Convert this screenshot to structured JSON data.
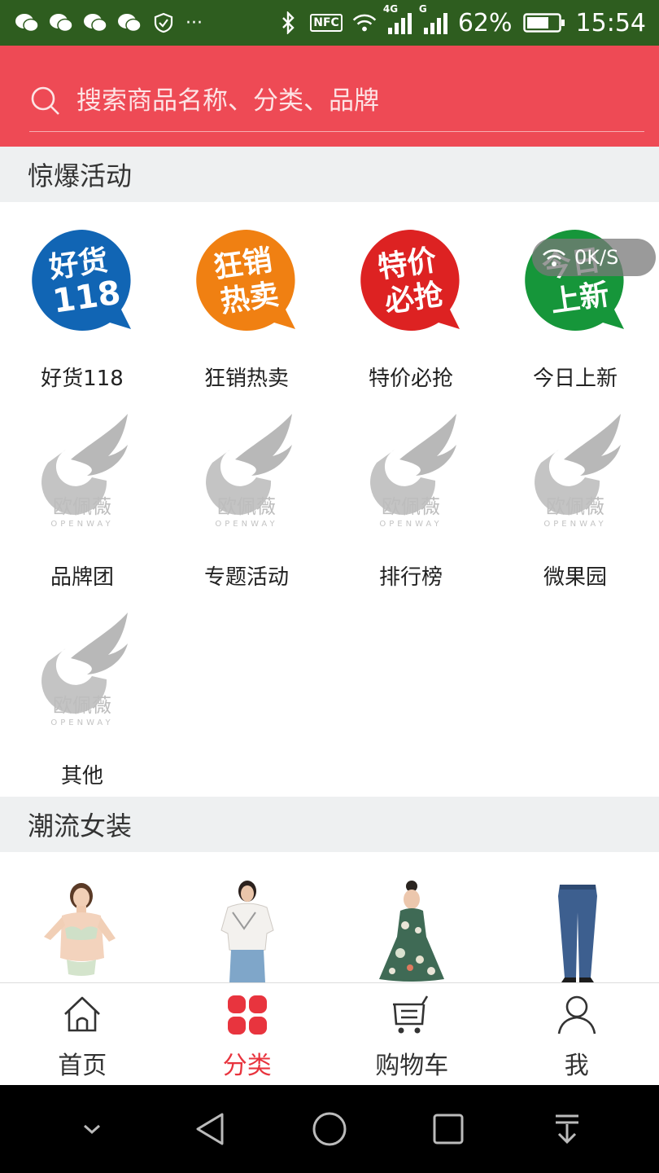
{
  "status_bar": {
    "network_4g": "4G",
    "network_g": "G",
    "nfc": "NFC",
    "battery": "62%",
    "time": "15:54",
    "more": "···"
  },
  "search": {
    "placeholder": "搜索商品名称、分类、品牌"
  },
  "sections": {
    "activities_title": "惊爆活动",
    "fashion_title": "潮流女装"
  },
  "activities": [
    {
      "label": "好货118",
      "badge_text_1": "好货",
      "badge_text_2": "118",
      "badge_color": "#1165b4"
    },
    {
      "label": "狂销热卖",
      "badge_text_1": "狂销",
      "badge_text_2": "热卖",
      "badge_color": "#f08012"
    },
    {
      "label": "特价必抢",
      "badge_text_1": "特价",
      "badge_text_2": "必抢",
      "badge_color": "#dd2222"
    },
    {
      "label": "今日上新",
      "badge_text_1": "今日",
      "badge_text_2": "上新",
      "badge_color": "#16963a"
    },
    {
      "label": "品牌团"
    },
    {
      "label": "专题活动"
    },
    {
      "label": "排行榜"
    },
    {
      "label": "微果园"
    },
    {
      "label": "其他"
    }
  ],
  "placeholder_logo": {
    "name_cn": "欧佩薇",
    "name_en": "OPENWAY"
  },
  "net_speed": "0K/S",
  "tabs": [
    {
      "label": "首页",
      "icon": "home-icon"
    },
    {
      "label": "分类",
      "icon": "category-icon",
      "active": true
    },
    {
      "label": "购物车",
      "icon": "cart-icon"
    },
    {
      "label": "我",
      "icon": "user-icon"
    }
  ],
  "colors": {
    "header_red": "#ee4a55",
    "active_tab": "#e8343e",
    "status_bar": "#2e5d1f"
  }
}
